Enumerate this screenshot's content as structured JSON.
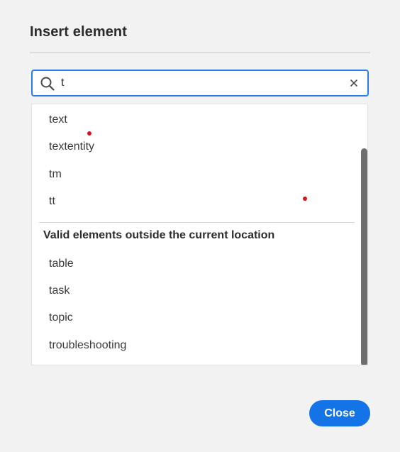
{
  "dialog": {
    "title": "Insert element"
  },
  "search": {
    "value": "t",
    "placeholder": ""
  },
  "list": {
    "current_items": [
      {
        "label": "text"
      },
      {
        "label": "textentity"
      },
      {
        "label": "tm"
      },
      {
        "label": "tt"
      }
    ],
    "outside_heading": "Valid elements outside the current location",
    "outside_items": [
      {
        "label": "table"
      },
      {
        "label": "task"
      },
      {
        "label": "topic"
      },
      {
        "label": "troubleshooting"
      }
    ]
  },
  "footer": {
    "close_label": "Close"
  },
  "colors": {
    "accent": "#1473e6",
    "focus_border": "#2680eb",
    "marker_dot": "#d7141e"
  },
  "icons": {
    "search": "search-icon",
    "clear": "close-icon"
  }
}
